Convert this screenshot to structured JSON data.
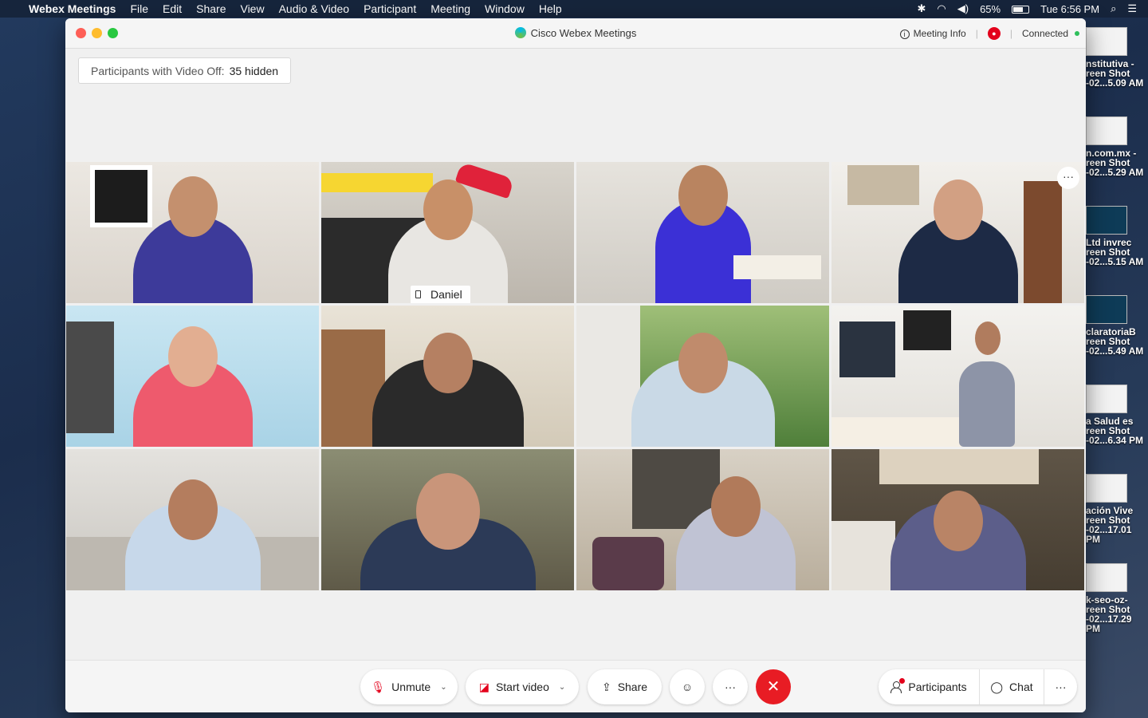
{
  "menubar": {
    "app_name": "Webex Meetings",
    "items": [
      "File",
      "Edit",
      "Share",
      "View",
      "Audio & Video",
      "Participant",
      "Meeting",
      "Window",
      "Help"
    ],
    "battery": "65%",
    "clock": "Tue 6:56 PM"
  },
  "desktop": {
    "items": [
      {
        "line1": "nstitutiva -",
        "line2": "reen Shot",
        "line3": "-02...5.09 AM",
        "dark": false
      },
      {
        "line1": "n.com.mx -",
        "line2": "reen Shot",
        "line3": "-02...5.29 AM",
        "dark": false
      },
      {
        "line1": "Ltd invrec",
        "line2": "reen Shot",
        "line3": "-02...5.15 AM",
        "dark": true
      },
      {
        "line1": "claratoriaB",
        "line2": "reen Shot",
        "line3": "-02...5.49 AM",
        "dark": true
      },
      {
        "line1": "a Salud es",
        "line2": "reen Shot",
        "line3": "-02...6.34 PM",
        "dark": false
      },
      {
        "line1": "ación Vive",
        "line2": "reen Shot",
        "line3": "-02...17.01 PM",
        "dark": false
      },
      {
        "line1": "k-seo-oz-",
        "line2": "reen Shot",
        "line3": "-02...17.29 PM",
        "dark": false
      }
    ]
  },
  "window": {
    "title": "Cisco Webex Meetings",
    "meeting_info": "Meeting Info",
    "connection_status": "Connected",
    "video_off_label": "Participants with Video Off:",
    "video_off_count": "35 hidden"
  },
  "grid": {
    "active_speaker_name": "Daniel",
    "tile_more": "···"
  },
  "controls": {
    "unmute": "Unmute",
    "start_video": "Start video",
    "share": "Share",
    "more": "···",
    "end": "✕",
    "participants": "Participants",
    "chat": "Chat",
    "right_more": "···"
  },
  "colors": {
    "end_button": "#e81c24",
    "recording": "#e3001b",
    "connected_dot": "#2fbf5b",
    "mute_icon": "#e3001b"
  }
}
